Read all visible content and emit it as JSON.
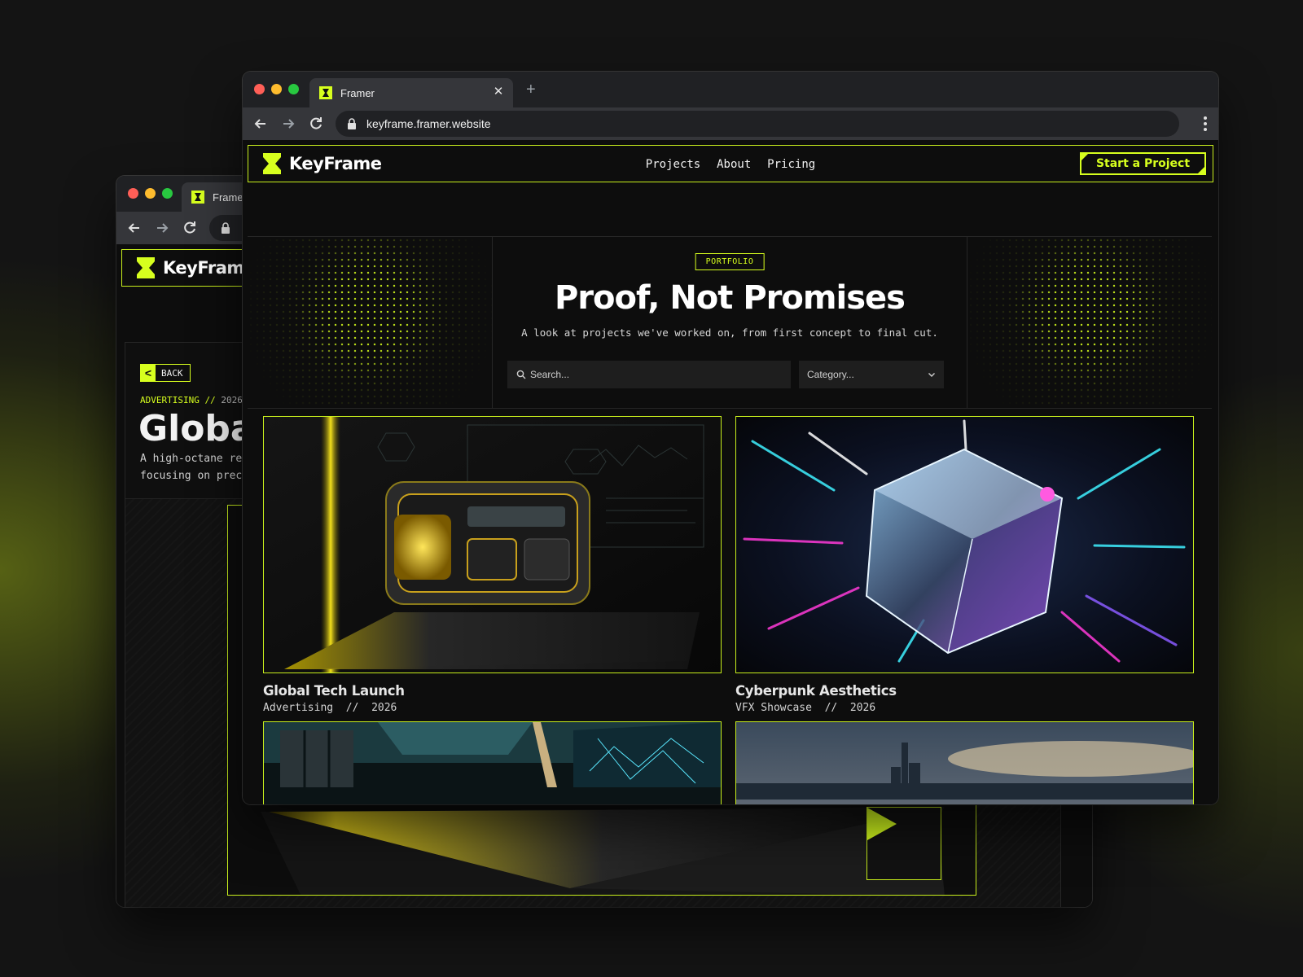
{
  "accent_color": "#d7ff1e",
  "back_window": {
    "tab_title": "Framer",
    "logo_text": "KeyFrame",
    "back_button": "BACK",
    "category": "ADVERTISING",
    "separator": "//",
    "year": "2026",
    "title": "Global Tech Launch",
    "description_line1": "A high-octane reveal",
    "description_line2": "focusing on precision"
  },
  "front_window": {
    "tab_title": "Framer",
    "url": "keyframe.framer.website",
    "nav": {
      "logo_text": "KeyFrame",
      "links": [
        "Projects",
        "About",
        "Pricing"
      ],
      "cta_label": "Start a Project"
    },
    "hero": {
      "badge": "PORTFOLIO",
      "title": "Proof, Not Promises",
      "subtitle": "A look at projects we've worked on, from first concept to final cut.",
      "search_placeholder": "Search...",
      "category_placeholder": "Category..."
    },
    "projects": [
      {
        "title": "Global Tech Launch",
        "category": "Advertising",
        "year": "2026",
        "image": "gold-tech-device"
      },
      {
        "title": "Cyberpunk Aesthetics",
        "category": "VFX Showcase",
        "year": "2026",
        "image": "neon-glass-cube"
      },
      {
        "title": "",
        "category": "",
        "year": "",
        "image": "control-room"
      },
      {
        "title": "",
        "category": "",
        "year": "",
        "image": "city-skyline"
      }
    ]
  }
}
